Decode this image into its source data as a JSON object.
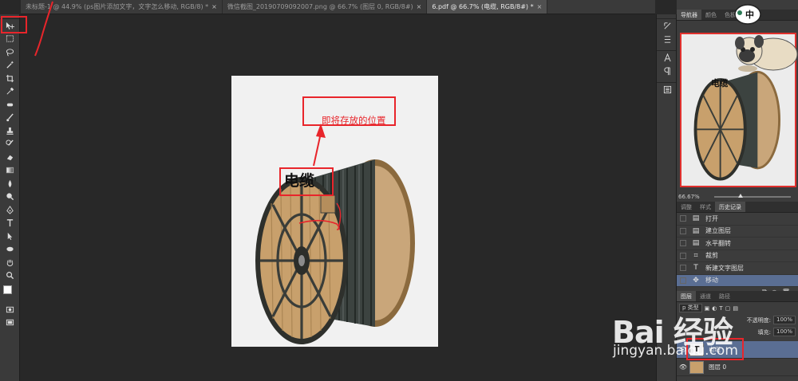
{
  "tabs": [
    {
      "label": "未标题-1 @ 44.9% (ps图片添加文字，文字怎么移动, RGB/8) *",
      "active": false
    },
    {
      "label": "微信截图_20190709092007.png @ 66.7% (图层 0, RGB/8#)",
      "active": false
    },
    {
      "label": "6.pdf @ 66.7% (电缆, RGB/8#) *",
      "active": true
    }
  ],
  "tab_close": "×",
  "canvas": {
    "annotation_text": "即将存放的位置",
    "reel_label": "电缆"
  },
  "navigator": {
    "tabs": [
      "导航器",
      "颜色",
      "色板"
    ],
    "zoom": "66.67%"
  },
  "history": {
    "tabs": [
      "调整",
      "样式",
      "历史记录"
    ],
    "items": [
      {
        "label": "打开",
        "icon": "document-icon"
      },
      {
        "label": "建立图层",
        "icon": "document-icon"
      },
      {
        "label": "水平翻转",
        "icon": "document-icon"
      },
      {
        "label": "裁剪",
        "icon": "crop-icon"
      },
      {
        "label": "新建文字图层",
        "icon": "text-icon"
      },
      {
        "label": "移动",
        "icon": "move-icon",
        "selected": true
      }
    ]
  },
  "layers": {
    "tabs": [
      "图层",
      "通道",
      "路径"
    ],
    "kind_filter": "p 类型",
    "opacity_label": "不透明度:",
    "opacity_value": "100%",
    "fill_label": "填充:",
    "fill_value": "100%",
    "items": [
      {
        "name": "电缆",
        "type": "text",
        "selected": true
      },
      {
        "name": "图层 0",
        "type": "image",
        "selected": false
      }
    ]
  },
  "mascot": {
    "badge": "中"
  },
  "watermark": {
    "logo": "Bai 经验",
    "url": "jingyan.baidu.com"
  },
  "colors": {
    "annotation_red": "#e8252b",
    "selection_blue": "#5a6e93",
    "panel": "#3c3c3c",
    "canvas": "#282828"
  }
}
